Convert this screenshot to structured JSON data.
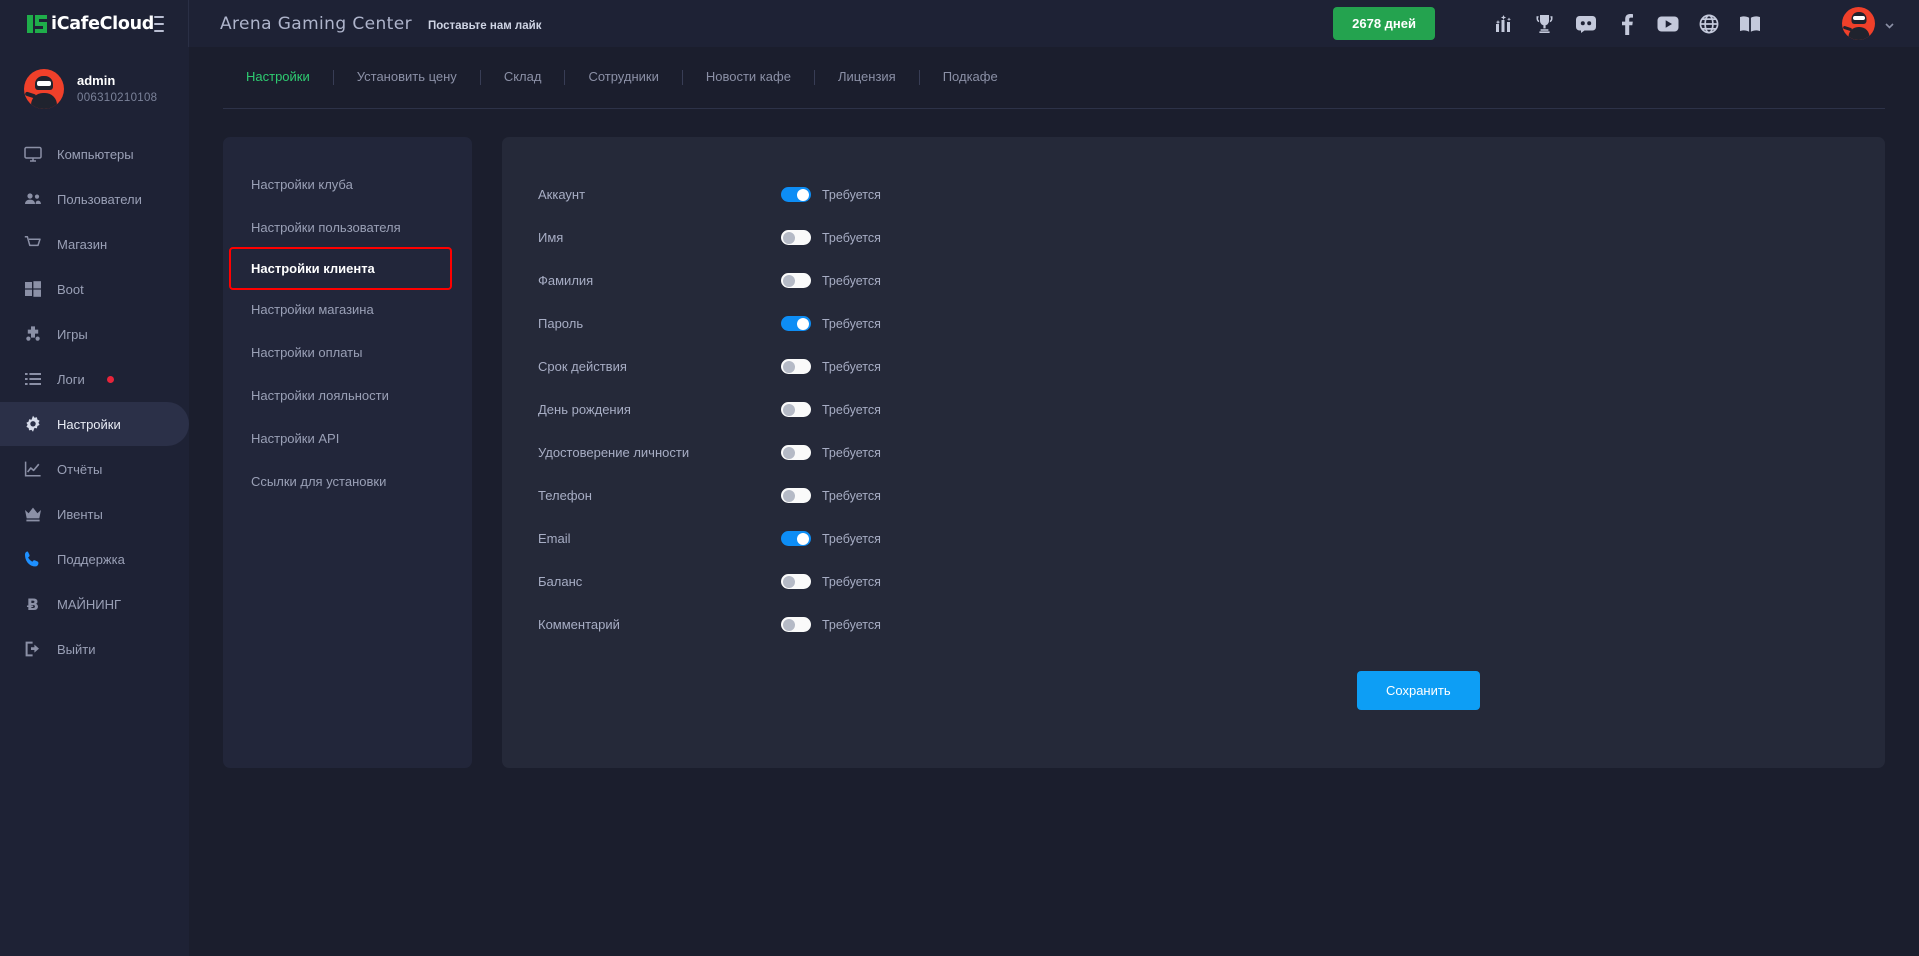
{
  "brand": {
    "name": "iCafeCloud",
    "logo_icon": "icafecloud-logo-icon",
    "menu_toggle_icon": "hamburger-icon"
  },
  "header": {
    "club_name": "Arena Gaming Center",
    "like_us_label": "Поставьте нам лайк",
    "days_badge": "2678 дней",
    "icons": [
      {
        "name": "ranking-chart-icon",
        "title": "Рейтинг"
      },
      {
        "name": "trophy-icon",
        "title": "Турниры"
      },
      {
        "name": "discord-icon",
        "title": "Discord"
      },
      {
        "name": "facebook-icon",
        "title": "Facebook"
      },
      {
        "name": "youtube-icon",
        "title": "YouTube"
      },
      {
        "name": "globe-icon",
        "title": "Язык"
      },
      {
        "name": "book-icon",
        "title": "Документация"
      }
    ],
    "avatar_icon": "ninja-avatar",
    "dropdown_icon": "chevron-down-icon"
  },
  "sidebar": {
    "user": {
      "name": "admin",
      "id": "006310210108",
      "avatar_icon": "ninja-avatar"
    },
    "items": [
      {
        "label": "Компьютеры",
        "icon": "monitor-icon",
        "active": false,
        "badge": false
      },
      {
        "label": "Пользователи",
        "icon": "users-icon",
        "active": false,
        "badge": false
      },
      {
        "label": "Магазин",
        "icon": "cart-icon",
        "active": false,
        "badge": false
      },
      {
        "label": "Boot",
        "icon": "windows-icon",
        "active": false,
        "badge": false
      },
      {
        "label": "Игры",
        "icon": "gamepad-icon",
        "active": false,
        "badge": false
      },
      {
        "label": "Логи",
        "icon": "list-icon",
        "active": false,
        "badge": true
      },
      {
        "label": "Настройки",
        "icon": "gear-icon",
        "active": true,
        "badge": false
      },
      {
        "label": "Отчёты",
        "icon": "chart-line-icon",
        "active": false,
        "badge": false
      },
      {
        "label": "Ивенты",
        "icon": "crown-icon",
        "active": false,
        "badge": false
      },
      {
        "label": "Поддержка",
        "icon": "phone-icon",
        "active": false,
        "badge": false
      },
      {
        "label": "МАЙНИНГ",
        "icon": "bitcoin-icon",
        "active": false,
        "badge": false
      },
      {
        "label": "Выйти",
        "icon": "logout-icon",
        "active": false,
        "badge": false
      }
    ]
  },
  "tabs": [
    {
      "label": "Настройки",
      "active": true
    },
    {
      "label": "Установить цену",
      "active": false
    },
    {
      "label": "Склад",
      "active": false
    },
    {
      "label": "Сотрудники",
      "active": false
    },
    {
      "label": "Новости кафе",
      "active": false
    },
    {
      "label": "Лицензия",
      "active": false
    },
    {
      "label": "Подкафе",
      "active": false
    }
  ],
  "settings_menu": [
    {
      "label": "Настройки клуба",
      "selected": false
    },
    {
      "label": "Настройки пользователя",
      "selected": false
    },
    {
      "label": "Настройки клиента",
      "selected": true
    },
    {
      "label": "Настройки магазина",
      "selected": false
    },
    {
      "label": "Настройки оплаты",
      "selected": false
    },
    {
      "label": "Настройки лояльности",
      "selected": false
    },
    {
      "label": "Настройки API",
      "selected": false
    },
    {
      "label": "Ссылки для установки",
      "selected": false
    }
  ],
  "client_settings": {
    "toggle_text": "Требуется",
    "fields": [
      {
        "label": "Аккаунт",
        "toggle_text": "Требуется",
        "on": true
      },
      {
        "label": "Имя",
        "toggle_text": "Требуется",
        "on": false
      },
      {
        "label": "Фамилия",
        "toggle_text": "Требуется",
        "on": false
      },
      {
        "label": "Пароль",
        "toggle_text": "Требуется",
        "on": true
      },
      {
        "label": "Срок действия",
        "toggle_text": "Требуется",
        "on": false
      },
      {
        "label": "День рождения",
        "toggle_text": "Требуется",
        "on": false
      },
      {
        "label": "Удостоверение личности",
        "toggle_text": "Требуется",
        "on": false
      },
      {
        "label": "Телефон",
        "toggle_text": "Требуется",
        "on": false
      },
      {
        "label": "Email",
        "toggle_text": "Требуется",
        "on": true
      },
      {
        "label": "Баланс",
        "toggle_text": "Требуется",
        "on": false
      },
      {
        "label": "Комментарий",
        "toggle_text": "Требуется",
        "on": false
      }
    ],
    "save_label": "Сохранить"
  },
  "colors": {
    "page_bg": "#1b1e2d",
    "card_bg": "#252939",
    "sidebar_bg": "#1e2235",
    "accent_green": "#2ecc71",
    "badge_green": "#24a34f",
    "accent_blue": "#0d9ef5",
    "toggle_on": "#0d8df5",
    "highlight_red": "#ff0000",
    "avatar_red": "#f0402a",
    "log_dot_red": "#e8243a"
  }
}
